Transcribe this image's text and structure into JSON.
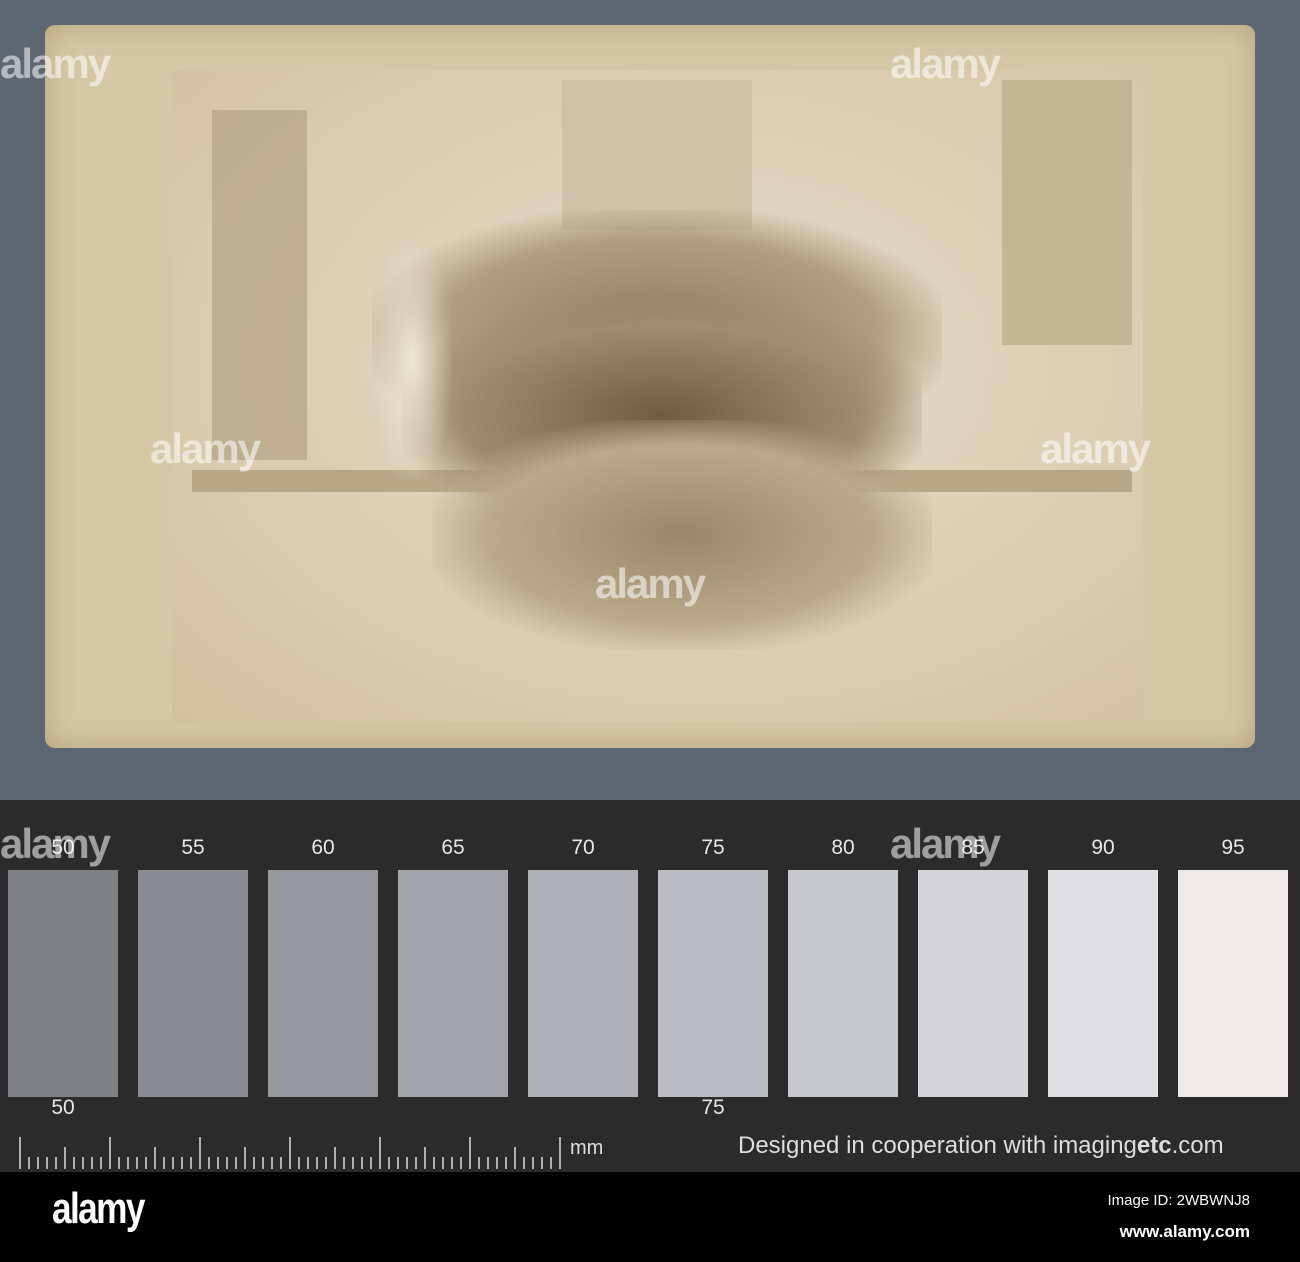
{
  "chart": {
    "top_labels": [
      "50",
      "55",
      "60",
      "65",
      "70",
      "75",
      "80",
      "85",
      "90",
      "95"
    ],
    "bottom_labels": [
      "50",
      "75"
    ],
    "patch_colors": [
      "#7f8084",
      "#8b8c91",
      "#97989d",
      "#a3a4a9",
      "#afb0b5",
      "#bbbcc1",
      "#c7c8cc",
      "#d4d4d8",
      "#e0e0e3",
      "#ece9e8"
    ],
    "unit": "mm",
    "credit_prefix": "Designed in cooperation with imaging",
    "credit_bold": "etc",
    "credit_suffix": ".com"
  },
  "watermark": "alamy",
  "footer": {
    "logo": "alamy",
    "image_id": "Image ID: 2WBWNJ8",
    "site": "www.alamy.com"
  }
}
